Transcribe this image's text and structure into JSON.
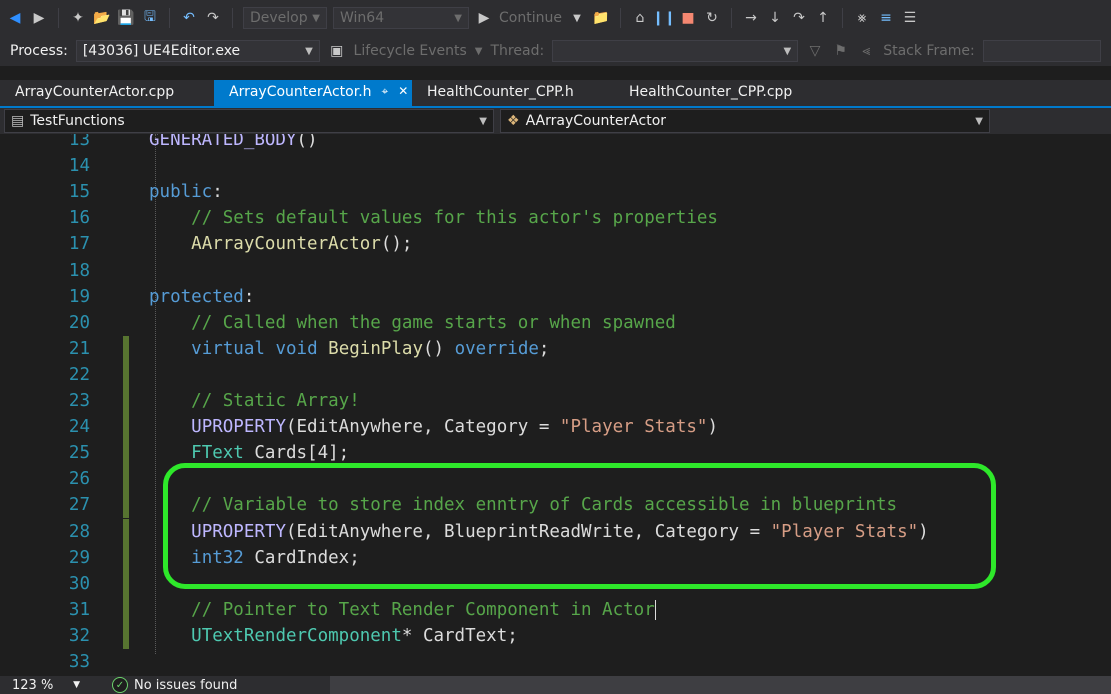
{
  "toolbar": {
    "config": "Develop",
    "platform": "Win64",
    "continue_label": "Continue"
  },
  "process_bar": {
    "process_label": "Process:",
    "process_value": "[43036] UE4Editor.exe",
    "lifecycle_label": "Lifecycle Events",
    "thread_label": "Thread:",
    "stack_frame_label": "Stack Frame:"
  },
  "tabs": [
    {
      "label": "ArrayCounterActor.cpp",
      "active": false
    },
    {
      "label": "ArrayCounterActor.h",
      "active": true
    },
    {
      "label": "HealthCounter_CPP.h",
      "active": false
    },
    {
      "label": "HealthCounter_CPP.cpp",
      "active": false
    }
  ],
  "nav": {
    "scope": "TestFunctions",
    "member": "AArrayCounterActor"
  },
  "lines": [
    {
      "n": "13",
      "html": "<span class='mac'>GENERATED_BODY</span>()"
    },
    {
      "n": "14",
      "html": ""
    },
    {
      "n": "15",
      "html": "<span class='kw'>public</span>:"
    },
    {
      "n": "16",
      "html": "    <span class='cm'>// Sets default values for this actor's properties</span>"
    },
    {
      "n": "17",
      "html": "    <span class='fn'>AArrayCounterActor</span>();"
    },
    {
      "n": "18",
      "html": ""
    },
    {
      "n": "19",
      "html": "<span class='kw'>protected</span>:"
    },
    {
      "n": "20",
      "html": "    <span class='cm'>// Called when the game starts or when spawned</span>"
    },
    {
      "n": "21",
      "html": "    <span class='kw'>virtual</span> <span class='kw'>void</span> <span class='fn'>BeginPlay</span>() <span class='kw'>override</span>;"
    },
    {
      "n": "22",
      "html": ""
    },
    {
      "n": "23",
      "html": "    <span class='cm'>// Static Array!</span>"
    },
    {
      "n": "24",
      "html": "    <span class='mac'>UPROPERTY</span>(EditAnywhere, Category = <span class='st'>\"Player Stats\"</span>)"
    },
    {
      "n": "25",
      "html": "    <span class='ty'>FText</span> Cards[4];"
    },
    {
      "n": "26",
      "html": ""
    },
    {
      "n": "27",
      "html": "    <span class='cm'>// Variable to store index enntry of Cards accessible in blueprints</span>"
    },
    {
      "n": "28",
      "html": "    <span class='mac'>UPROPERTY</span>(EditAnywhere, BlueprintReadWrite, Category = <span class='st'>\"Player Stats\"</span>)"
    },
    {
      "n": "29",
      "html": "    <span class='kw'>int32</span> CardIndex;"
    },
    {
      "n": "30",
      "html": ""
    },
    {
      "n": "31",
      "html": "    <span class='cm'>// Pointer to Text Render Component in Actor</span>"
    },
    {
      "n": "32",
      "html": "    <span class='ty'>UTextRenderComponent</span>* CardText;"
    },
    {
      "n": "33",
      "html": ""
    }
  ],
  "changed_lines": [
    "21",
    "22",
    "23",
    "24",
    "25",
    "26",
    "27",
    "28",
    "29",
    "30",
    "31",
    "32"
  ],
  "status": {
    "zoom": "123 %",
    "issues": "No issues found"
  },
  "colors": {
    "accent": "#007acc",
    "highlight_ring": "#2ee82a",
    "change_bar": "#577430"
  }
}
